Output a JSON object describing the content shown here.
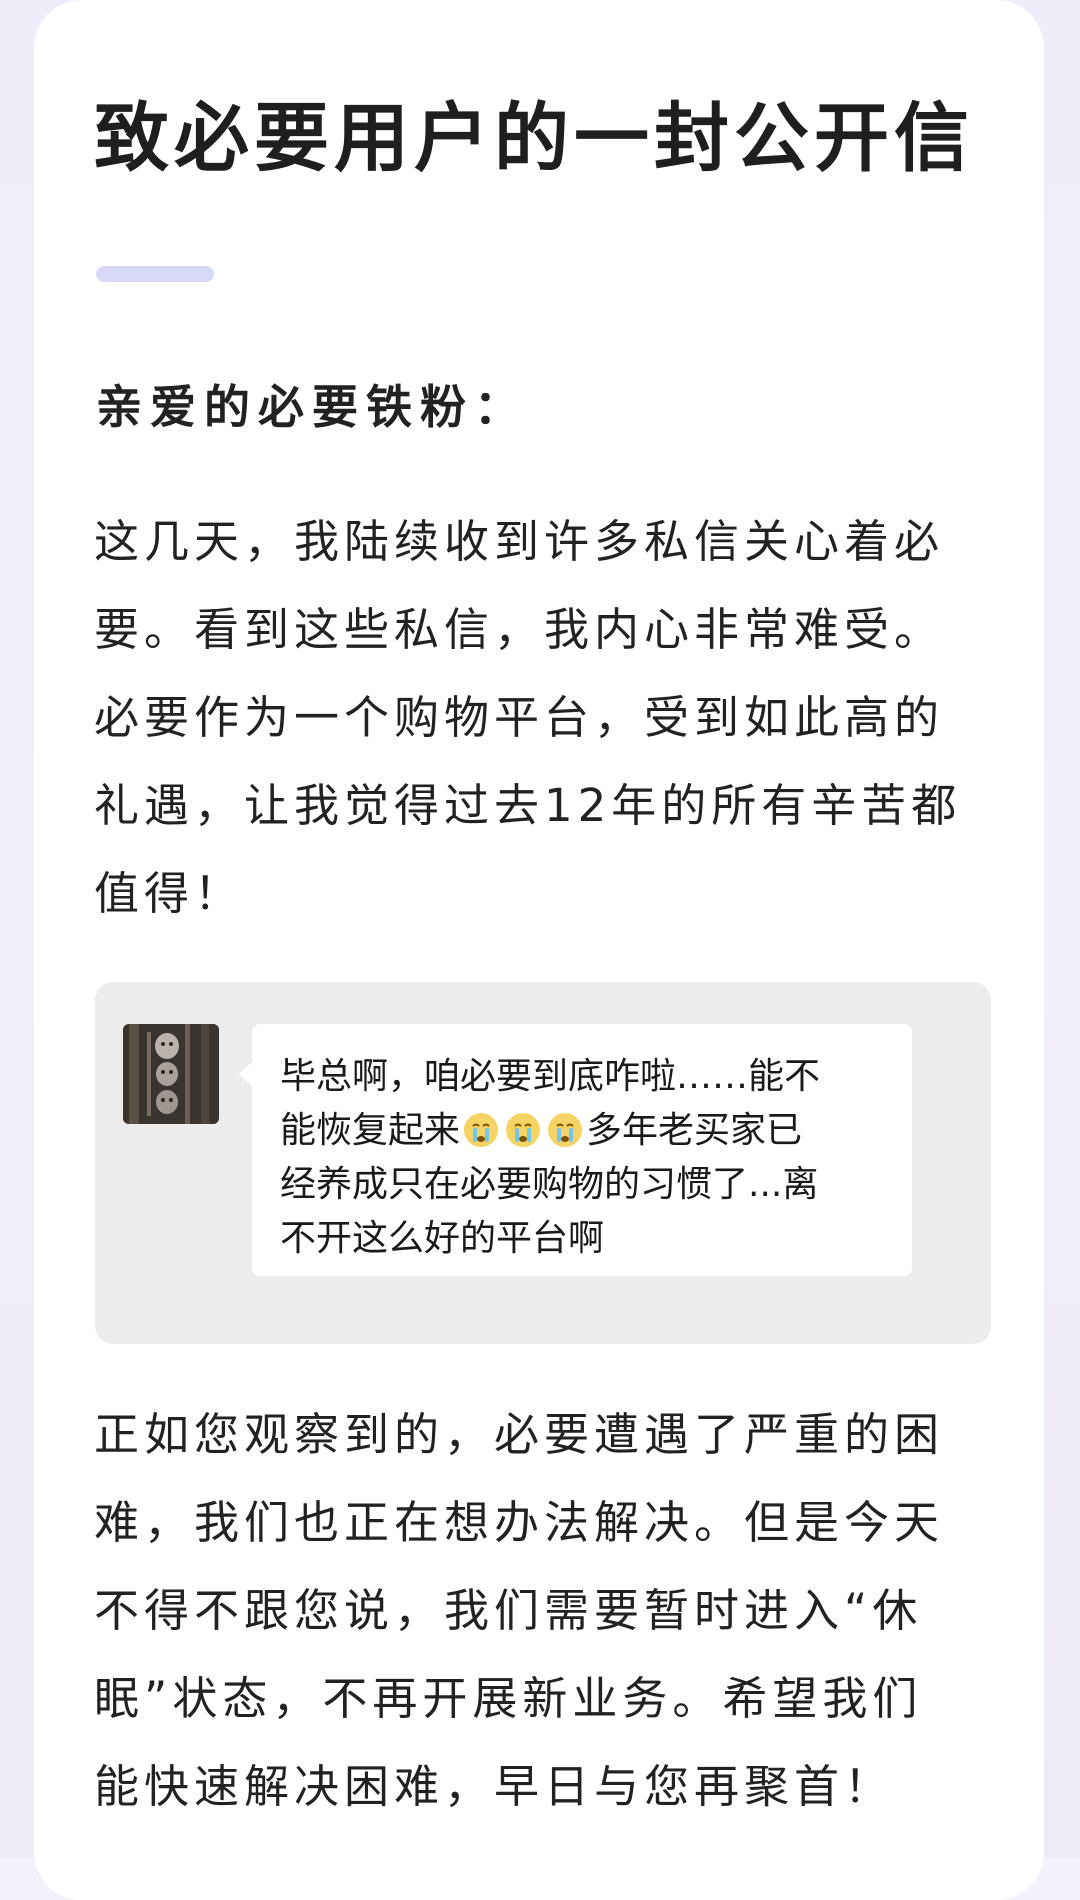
{
  "letter": {
    "title": "致必要用户的一封公开信",
    "greeting": "亲爱的必要铁粉：",
    "paragraph1": [
      "这几天，我陆续收到许多私信关心着必",
      "要。看到这些私信，我内心非常难受。",
      "必要作为一个购物平台，受到如此高的",
      "礼遇，让我觉得过去12年的所有辛苦都",
      "值得！"
    ],
    "paragraph2": [
      "正如您观察到的，必要遭遇了严重的困",
      "难，我们也正在想办法解决。但是今天",
      "不得不跟您说，我们需要暂时进入“休",
      "眠”状态，不再开展新业务。希望我们",
      "能快速解决困难，早日与您再聚首！"
    ]
  },
  "quoted_message": {
    "line1": "毕总啊，咱必要到底咋啦……能不",
    "line2_before_emoji": "能恢复起来",
    "emoji_icon": "crying-face-emoji",
    "emoji_count": 3,
    "line2_after_emoji": "多年老买家已",
    "line3": "经养成只在必要购物的习惯了...离",
    "line4": "不开这么好的平台啊"
  },
  "colors": {
    "background": "#f1eff9",
    "card": "#ffffff",
    "accent_bar": "#d9d8f7",
    "quote_background": "#ececec",
    "text": "#222222"
  }
}
